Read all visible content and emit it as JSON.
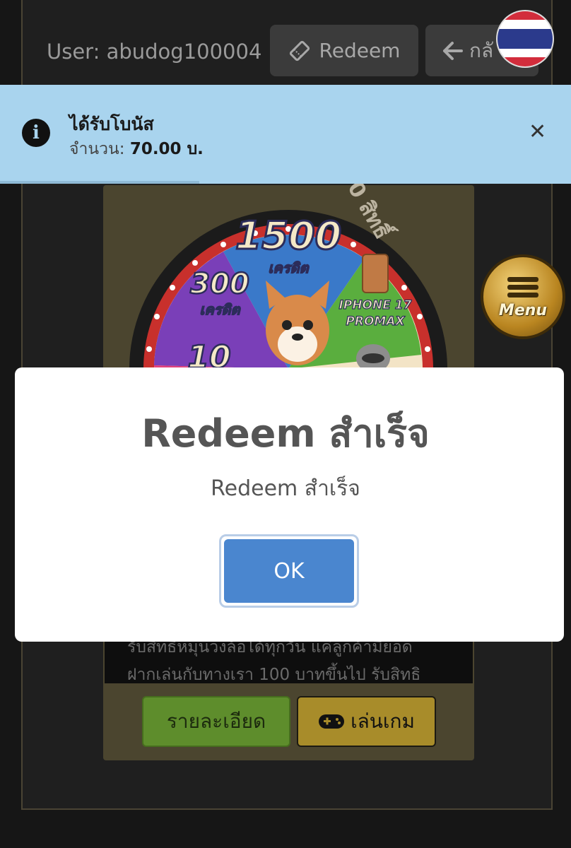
{
  "header": {
    "user_label": "User: abudog100004",
    "redeem_label": "Redeem",
    "back_label": "กลั"
  },
  "notification": {
    "title": "ได้รับโบนัส",
    "message_prefix": "จำนวน: ",
    "amount": "70.00 บ.",
    "close_icon": "close-icon"
  },
  "wheel": {
    "ribbon_text": "0 สิทธิ์",
    "segments": [
      {
        "value": "1500",
        "unit": "เครดิต",
        "color": "#3a79c9"
      },
      {
        "value": "300",
        "unit": "เครดิต",
        "color": "#7a3fb8"
      },
      {
        "value": "10",
        "unit": "",
        "color": "#e0407c"
      },
      {
        "value": "IPHONE 17",
        "unit": "PROMAX",
        "color": "#5aae3e"
      }
    ]
  },
  "menu_button": {
    "label": "Menu"
  },
  "promo": {
    "line1": "รับสิทธิหมุนวงล้อได้ทุกวัน แค่ลูกค้ามียอด",
    "line2": "ฝากเล่นกับทางเรา 100 บาทขึ้นไป รับสิทธิ"
  },
  "actions": {
    "detail_label": "รายละเอียด",
    "play_label": "เล่นเกม"
  },
  "modal": {
    "title": "Redeem สำเร็จ",
    "text": "Redeem สำเร็จ",
    "ok_label": "OK"
  },
  "colors": {
    "background": "#161616",
    "toast_bg": "#a9d4ee",
    "ok_button": "#4a86cf",
    "detail_button": "#5e8d2c",
    "play_button": "#a88c2a"
  }
}
